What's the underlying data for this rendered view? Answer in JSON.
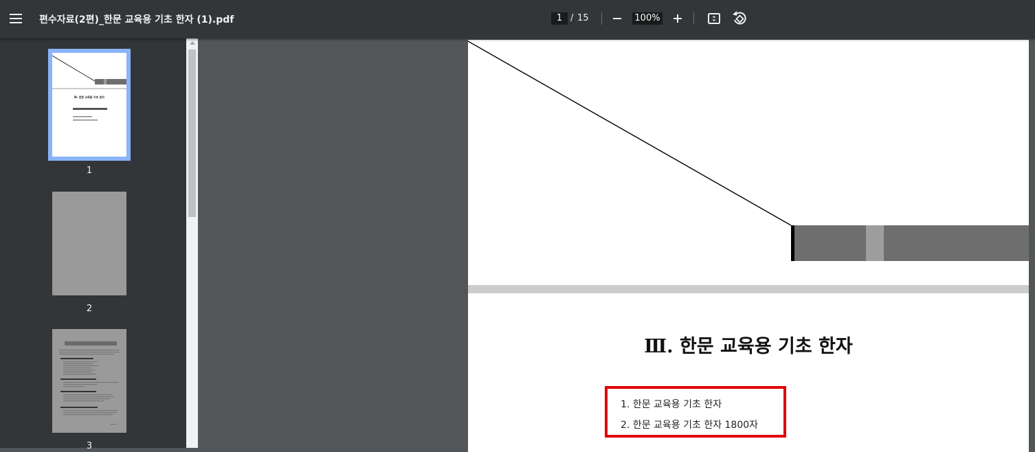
{
  "toolbar": {
    "icons": {
      "menu": "hamburger-menu-icon",
      "zoom_out": "minus-icon",
      "zoom_in": "plus-icon",
      "fit": "fit-to-page-icon",
      "rotate": "rotate-icon"
    },
    "title": "편수자료(2편)_한문 교육용 기초 한자 (1).pdf",
    "page_current": "1",
    "page_separator": "/",
    "page_total": "15",
    "zoom": "100%"
  },
  "sidebar": {
    "thumbnails": [
      {
        "number": "1",
        "selected": true
      },
      {
        "number": "2",
        "selected": false
      },
      {
        "number": "3",
        "selected": false
      }
    ],
    "thumb1_heading": "Ⅲ. 한문 교육용 기초 한자"
  },
  "document": {
    "chapter_title": "Ⅲ. 한문 교육용 기초 한자",
    "toc": [
      "1. 한문 교육용 기초 한자",
      "2. 한문 교육용 기초 한자 1800자"
    ]
  },
  "colors": {
    "toolbar_bg": "#323639",
    "viewer_bg": "#525659",
    "thumb_selected_border": "#8ab4f8",
    "highlight_box": "#e00000"
  }
}
